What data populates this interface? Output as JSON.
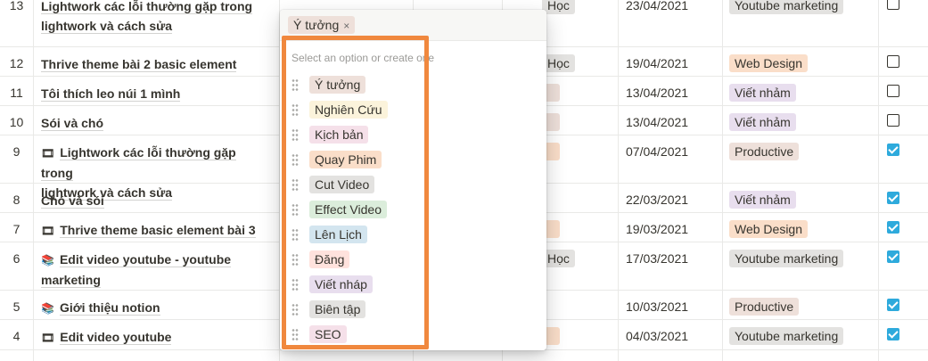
{
  "colors": {
    "accent_highlight": "#f0883e",
    "checkbox_checked": "#2eaadc"
  },
  "tag_colors": {
    "gray": "#e3e2e0",
    "brown": "#eee0da",
    "orange": "#fadec9",
    "yellow": "#fbf3db",
    "purple": "#e8deee",
    "pink": "#f5e0e9",
    "green": "#dbeddb",
    "blue": "#d3e5ef",
    "red": "#ffe2dd"
  },
  "rows": [
    {
      "num": "13",
      "title_line1": "Lightwork các lỗi thường gặp trong",
      "title_line2": "lightwork và cách sửa",
      "icon": "",
      "status": "Học",
      "status_color": "gray",
      "date": "23/04/2021",
      "project": "Youtube marketing",
      "project_color": "gray",
      "done": false
    },
    {
      "num": "12",
      "title_line1": "Thrive theme bài 2 basic element",
      "title_line2": "",
      "icon": "",
      "status": "Học",
      "status_color": "gray",
      "date": "19/04/2021",
      "project": "Web Design",
      "project_color": "orange",
      "done": false
    },
    {
      "num": "11",
      "title_line1": "Tôi thích leo núi 1 mình",
      "title_line2": "",
      "icon": "",
      "status": "",
      "status_color": "brown",
      "date": "13/04/2021",
      "project": "Viết nhảm",
      "project_color": "purple",
      "done": false
    },
    {
      "num": "10",
      "title_line1": "Sói và chó",
      "title_line2": "",
      "icon": "",
      "status": "",
      "status_color": "brown",
      "date": "13/04/2021",
      "project": "Viết nhảm",
      "project_color": "purple",
      "done": false
    },
    {
      "num": "9",
      "title_line1": "Lightwork các lỗi thường gặp trong",
      "title_line2": "lightwork và cách sửa",
      "icon": "🎞",
      "status": "",
      "status_color": "orange",
      "date": "07/04/2021",
      "project": "Productive",
      "project_color": "brown",
      "done": true
    },
    {
      "num": "8",
      "title_line1": "Chó và sói",
      "title_line2": "",
      "icon": "",
      "status": "",
      "status_color": "",
      "date": "22/03/2021",
      "project": "Viết nhảm",
      "project_color": "purple",
      "done": true
    },
    {
      "num": "7",
      "title_line1": "Thrive theme basic element bài 3",
      "title_line2": "",
      "icon": "🎞",
      "status": "",
      "status_color": "orange",
      "date": "19/03/2021",
      "project": "Web Design",
      "project_color": "orange",
      "done": true
    },
    {
      "num": "6",
      "title_line1": "Edit video youtube - youtube",
      "title_line2": "marketing",
      "icon": "📚",
      "status": "Học",
      "status_color": "gray",
      "date": "17/03/2021",
      "project": "Youtube marketing",
      "project_color": "gray",
      "done": true
    },
    {
      "num": "5",
      "title_line1": "Giới thiệu notion",
      "title_line2": "",
      "icon": "📚",
      "status": "",
      "status_color": "",
      "date": "10/03/2021",
      "project": "Productive",
      "project_color": "brown",
      "done": true
    },
    {
      "num": "4",
      "title_line1": "Edit video youtube",
      "title_line2": "",
      "icon": "🎞",
      "status": "",
      "status_color": "orange",
      "date": "04/03/2021",
      "project": "Youtube marketing",
      "project_color": "gray",
      "done": true
    }
  ],
  "popup": {
    "selected": {
      "label": "Ý tưởng",
      "color": "brown",
      "remove_icon": "×"
    },
    "hint": "Select an option or create one",
    "options": [
      {
        "label": "Ý tưởng",
        "color": "brown"
      },
      {
        "label": "Nghiên Cứu",
        "color": "yellow"
      },
      {
        "label": "Kịch bản",
        "color": "pink"
      },
      {
        "label": "Quay Phim",
        "color": "orange"
      },
      {
        "label": "Cut Video",
        "color": "gray"
      },
      {
        "label": "Effect Video",
        "color": "green"
      },
      {
        "label": "Lên Lịch",
        "color": "blue"
      },
      {
        "label": "Đăng",
        "color": "red"
      },
      {
        "label": "Viết nháp",
        "color": "purple"
      },
      {
        "label": "Biên tập",
        "color": "gray"
      },
      {
        "label": "SEO",
        "color": "pink"
      }
    ]
  }
}
